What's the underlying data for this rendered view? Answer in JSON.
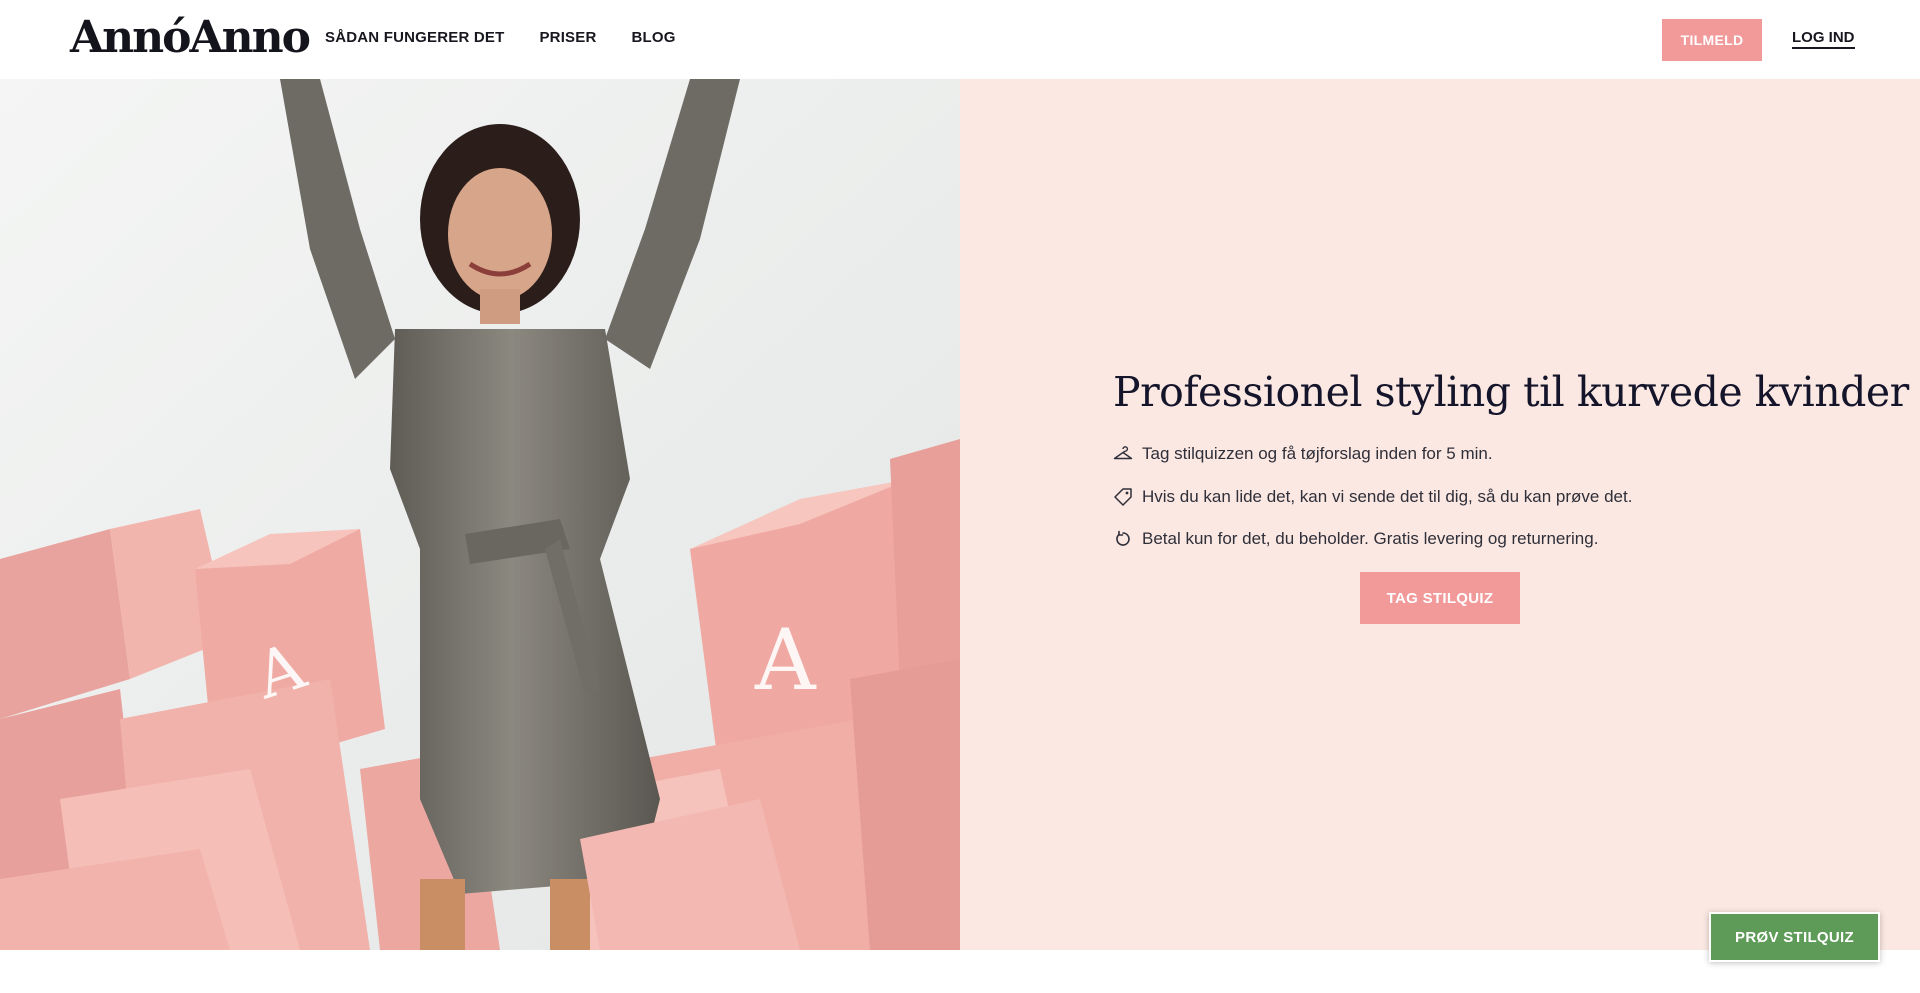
{
  "header": {
    "logo_text": "AnnóAnno",
    "nav": [
      "SÅDAN FUNGERER DET",
      "PRISER",
      "BLOG"
    ],
    "signup_label": "TILMELD",
    "login_label": "LOG IND"
  },
  "hero": {
    "image_alt": "Woman in a grey satin dress cheering among pink boxes",
    "headline": "Professionel styling til kurvede kvinder",
    "features": [
      {
        "icon": "hanger-icon",
        "text": "Tag stilquizzen og få tøjforslag inden for 5 min."
      },
      {
        "icon": "tag-icon",
        "text": "Hvis du kan lide det, kan vi sende det til dig, så du kan prøve det."
      },
      {
        "icon": "return-icon",
        "text": "Betal kun for det, du beholder. Gratis levering og returnering."
      }
    ],
    "cta_label": "TAG STILQUIZ"
  },
  "floating_cta": {
    "label": "PRØV STILQUIZ"
  },
  "colors": {
    "accent_pink": "#f29a9a",
    "panel_bg": "#fbe8e2",
    "cta_green": "#5e9a58",
    "text_dark": "#14142a"
  }
}
